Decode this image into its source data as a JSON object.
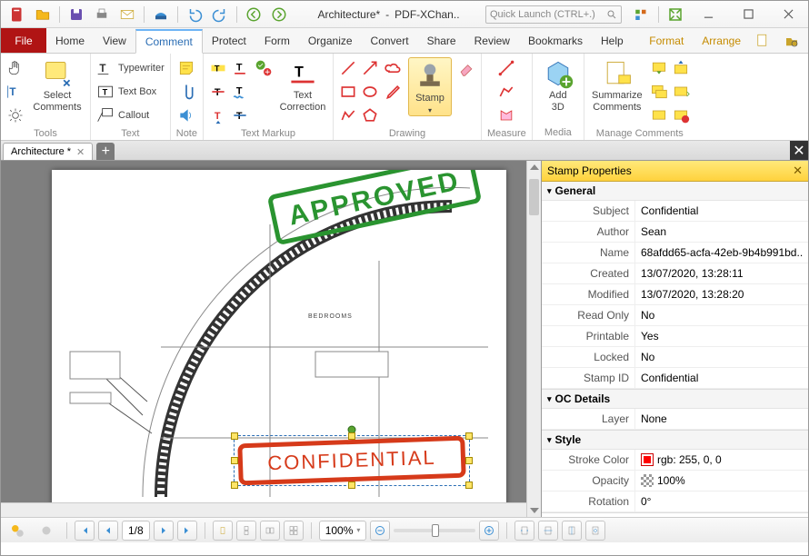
{
  "app": {
    "doc_title": "Architecture*",
    "app_name": "PDF-XChan..",
    "quick_launch_placeholder": "Quick Launch (CTRL+.)"
  },
  "tabs": {
    "file": "File",
    "items": [
      "Home",
      "View",
      "Comment",
      "Protect",
      "Form",
      "Organize",
      "Convert",
      "Share",
      "Review",
      "Bookmarks",
      "Help"
    ],
    "format": "Format",
    "arrange": "Arrange",
    "active_index": 2
  },
  "ribbon": {
    "tools": {
      "label": "Tools",
      "select": "Select\nComments"
    },
    "text": {
      "label": "Text",
      "typewriter": "Typewriter",
      "textbox": "Text Box",
      "callout": "Callout"
    },
    "note": {
      "label": "Note"
    },
    "markup": {
      "label": "Text Markup",
      "correction": "Text\nCorrection"
    },
    "drawing": {
      "label": "Drawing",
      "stamp": "Stamp"
    },
    "measure": {
      "label": "Measure"
    },
    "media": {
      "label": "Media",
      "add3d": "Add\n3D"
    },
    "manage": {
      "label": "Manage Comments",
      "summarize": "Summarize\nComments"
    }
  },
  "doc_tab": {
    "name": "Architecture *"
  },
  "stamps": {
    "approved": "APPROVED",
    "confidential": "CONFIDENTIAL"
  },
  "blueprint": {
    "room": "BEDROOMS"
  },
  "props": {
    "title": "Stamp Properties",
    "general": {
      "head": "General",
      "rows": [
        {
          "k": "Subject",
          "v": "Confidential"
        },
        {
          "k": "Author",
          "v": "Sean"
        },
        {
          "k": "Name",
          "v": "68afdd65-acfa-42eb-9b4b991bd.."
        },
        {
          "k": "Created",
          "v": "13/07/2020, 13:28:11"
        },
        {
          "k": "Modified",
          "v": "13/07/2020, 13:28:20"
        },
        {
          "k": "Read Only",
          "v": "No"
        },
        {
          "k": "Printable",
          "v": "Yes"
        },
        {
          "k": "Locked",
          "v": "No"
        },
        {
          "k": "Stamp ID",
          "v": "Confidential"
        }
      ]
    },
    "oc": {
      "head": "OC Details",
      "rows": [
        {
          "k": "Layer",
          "v": "None"
        }
      ]
    },
    "style": {
      "head": "Style",
      "stroke_k": "Stroke Color",
      "stroke_v": "rgb: 255, 0, 0",
      "opacity_k": "Opacity",
      "opacity_v": "100%",
      "rotation_k": "Rotation",
      "rotation_v": "0°"
    }
  },
  "status": {
    "page": "1/8",
    "zoom": "100%"
  }
}
